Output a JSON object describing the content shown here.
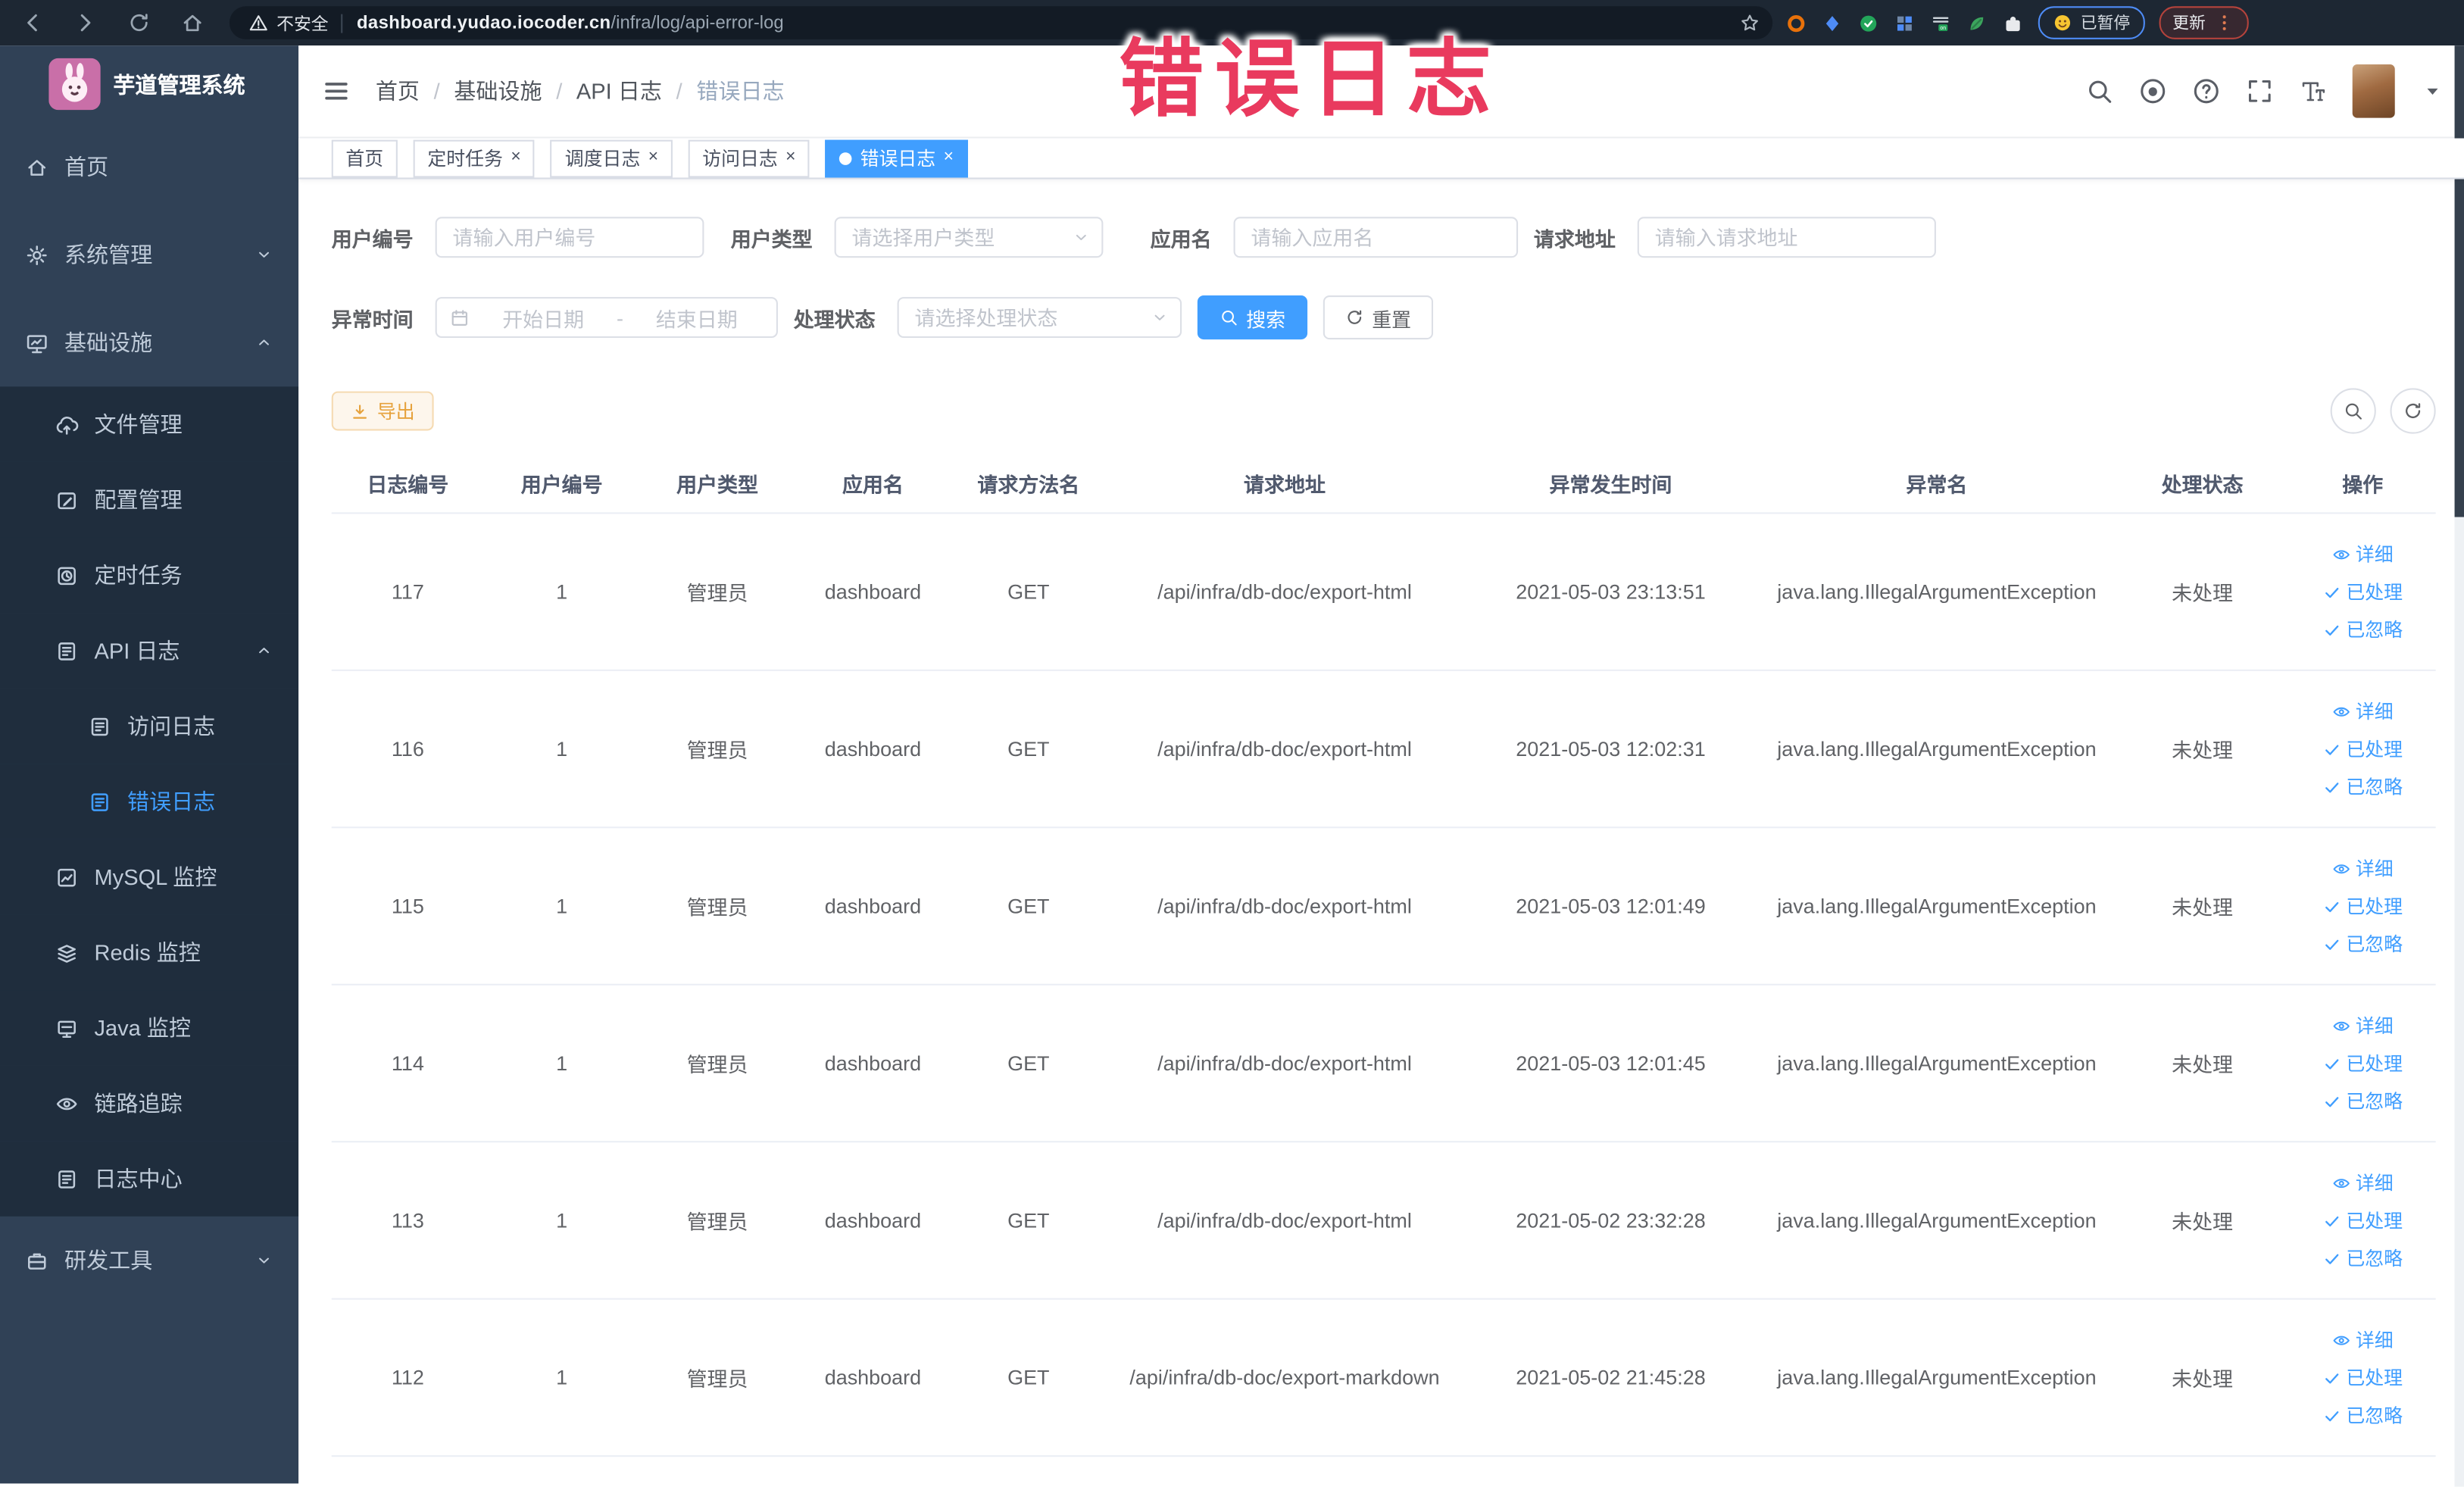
{
  "browser": {
    "security_label": "不安全",
    "url_host": "dashboard.yudao.iocoder.cn",
    "url_path": "/infra/log/api-error-log",
    "paused_badge": "已暂停",
    "update_button": "更新"
  },
  "annotation": {
    "text": "错误日志",
    "color": "#e93a5e"
  },
  "sidebar": {
    "title": "芋道管理系统",
    "menu": [
      {
        "label": "首页",
        "icon": "home-icon",
        "level": 1
      },
      {
        "label": "系统管理",
        "icon": "gear-icon",
        "level": 1,
        "arrow": "chevron-down-icon"
      },
      {
        "label": "基础设施",
        "icon": "infra-icon",
        "level": 1,
        "arrow": "chevron-up-icon"
      },
      {
        "label": "文件管理",
        "icon": "upload-icon",
        "level": 2
      },
      {
        "label": "配置管理",
        "icon": "edit-icon",
        "level": 2
      },
      {
        "label": "定时任务",
        "icon": "job-icon",
        "level": 2
      },
      {
        "label": "API 日志",
        "icon": "log-icon",
        "level": 2,
        "arrow": "chevron-up-icon"
      },
      {
        "label": "访问日志",
        "icon": "log-icon",
        "level": 3
      },
      {
        "label": "错误日志",
        "icon": "log-icon",
        "level": 3,
        "active": true
      },
      {
        "label": "MySQL 监控",
        "icon": "mysql-icon",
        "level": 2
      },
      {
        "label": "Redis 监控",
        "icon": "redis-icon",
        "level": 2
      },
      {
        "label": "Java 监控",
        "icon": "java-icon",
        "level": 2
      },
      {
        "label": "链路追踪",
        "icon": "trace-icon",
        "level": 2
      },
      {
        "label": "日志中心",
        "icon": "log-icon",
        "level": 2
      },
      {
        "label": "研发工具",
        "icon": "tool-icon",
        "level": 1,
        "arrow": "chevron-down-icon"
      }
    ]
  },
  "header": {
    "breadcrumb": [
      "首页",
      "基础设施",
      "API 日志",
      "错误日志"
    ]
  },
  "tabs": [
    {
      "label": "首页"
    },
    {
      "label": "定时任务",
      "closable": true
    },
    {
      "label": "调度日志",
      "closable": true
    },
    {
      "label": "访问日志",
      "closable": true
    },
    {
      "label": "错误日志",
      "closable": true,
      "active": true
    }
  ],
  "filters": {
    "user_id": {
      "label": "用户编号",
      "placeholder": "请输入用户编号"
    },
    "user_type": {
      "label": "用户类型",
      "placeholder": "请选择用户类型"
    },
    "app_name": {
      "label": "应用名",
      "placeholder": "请输入应用名"
    },
    "request_url": {
      "label": "请求地址",
      "placeholder": "请输入请求地址"
    },
    "exception_time": {
      "label": "异常时间",
      "start_placeholder": "开始日期",
      "separator": "-",
      "end_placeholder": "结束日期"
    },
    "process_status": {
      "label": "处理状态",
      "placeholder": "请选择处理状态"
    },
    "search_button": "搜索",
    "reset_button": "重置"
  },
  "toolbar": {
    "export_button": "导出"
  },
  "table": {
    "columns": [
      "日志编号",
      "用户编号",
      "用户类型",
      "应用名",
      "请求方法名",
      "请求地址",
      "异常发生时间",
      "异常名",
      "处理状态",
      "操作"
    ],
    "rows": [
      {
        "id": "117",
        "user_id": "1",
        "user_type": "管理员",
        "app_name": "dashboard",
        "method": "GET",
        "url": "/api/infra/db-doc/export-html",
        "time": "2021-05-03 23:13:51",
        "exception": "java.lang.IllegalArgumentException",
        "status": "未处理"
      },
      {
        "id": "116",
        "user_id": "1",
        "user_type": "管理员",
        "app_name": "dashboard",
        "method": "GET",
        "url": "/api/infra/db-doc/export-html",
        "time": "2021-05-03 12:02:31",
        "exception": "java.lang.IllegalArgumentException",
        "status": "未处理"
      },
      {
        "id": "115",
        "user_id": "1",
        "user_type": "管理员",
        "app_name": "dashboard",
        "method": "GET",
        "url": "/api/infra/db-doc/export-html",
        "time": "2021-05-03 12:01:49",
        "exception": "java.lang.IllegalArgumentException",
        "status": "未处理"
      },
      {
        "id": "114",
        "user_id": "1",
        "user_type": "管理员",
        "app_name": "dashboard",
        "method": "GET",
        "url": "/api/infra/db-doc/export-html",
        "time": "2021-05-03 12:01:45",
        "exception": "java.lang.IllegalArgumentException",
        "status": "未处理"
      },
      {
        "id": "113",
        "user_id": "1",
        "user_type": "管理员",
        "app_name": "dashboard",
        "method": "GET",
        "url": "/api/infra/db-doc/export-html",
        "time": "2021-05-02 23:32:28",
        "exception": "java.lang.IllegalArgumentException",
        "status": "未处理"
      },
      {
        "id": "112",
        "user_id": "1",
        "user_type": "管理员",
        "app_name": "dashboard",
        "method": "GET",
        "url": "/api/infra/db-doc/export-markdown",
        "time": "2021-05-02 21:45:28",
        "exception": "java.lang.IllegalArgumentException",
        "status": "未处理"
      }
    ],
    "actions": {
      "detail": "详细",
      "processed": "已处理",
      "ignored": "已忽略"
    }
  },
  "colors": {
    "accent": "#409eff",
    "sidebar": "#304156",
    "submenu": "#1f2d3d",
    "warning": "#e6a23c",
    "annotation_red": "#e93a5e"
  }
}
